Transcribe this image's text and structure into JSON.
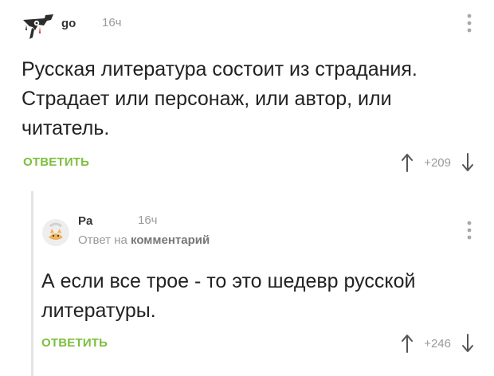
{
  "comments": [
    {
      "username": "go",
      "time": "16ч",
      "text": "Русская литература состоит из страдания. Страдает или персонаж, или автор, или читатель.",
      "reply_label": "ОТВЕТИТЬ",
      "rating": "+209",
      "avatar_icon": "hand-crest-icon"
    },
    {
      "username": "Pa",
      "time": "16ч",
      "reply_prefix": "Ответ на",
      "reply_target": "комментарий",
      "text": "А если все трое - то это шедевр русской литературы.",
      "reply_label": "ОТВЕТИТЬ",
      "rating": "+246",
      "avatar_icon": "cat-avatar-icon"
    }
  ],
  "colors": {
    "accent_green": "#7cbf3c",
    "muted_gray": "#9a9a9a",
    "text": "#222222"
  }
}
